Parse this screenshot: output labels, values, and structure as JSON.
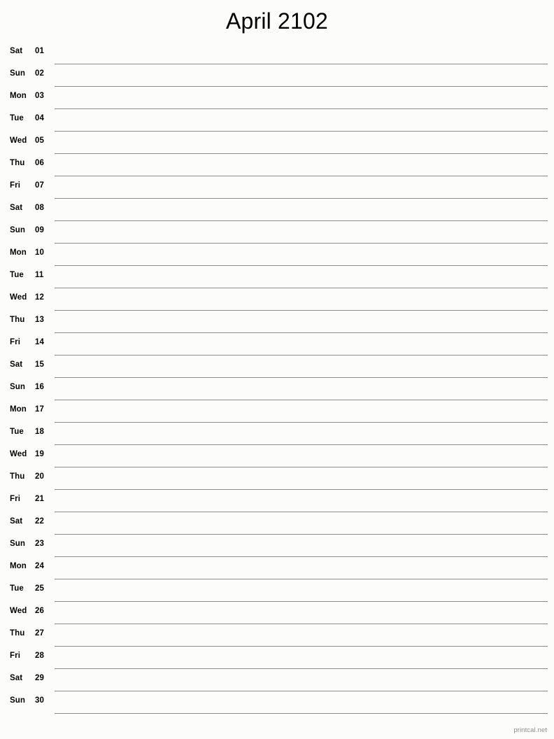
{
  "document": {
    "title": "April 2102",
    "footer_label": "printcal.net",
    "rule_color": "#8a8f88",
    "background_color": "#fcfdfa",
    "text_color": "#000000",
    "footer_color": "#8d8d8d"
  },
  "days": [
    {
      "weekday": "Sat",
      "number": "01"
    },
    {
      "weekday": "Sun",
      "number": "02"
    },
    {
      "weekday": "Mon",
      "number": "03"
    },
    {
      "weekday": "Tue",
      "number": "04"
    },
    {
      "weekday": "Wed",
      "number": "05"
    },
    {
      "weekday": "Thu",
      "number": "06"
    },
    {
      "weekday": "Fri",
      "number": "07"
    },
    {
      "weekday": "Sat",
      "number": "08"
    },
    {
      "weekday": "Sun",
      "number": "09"
    },
    {
      "weekday": "Mon",
      "number": "10"
    },
    {
      "weekday": "Tue",
      "number": "11"
    },
    {
      "weekday": "Wed",
      "number": "12"
    },
    {
      "weekday": "Thu",
      "number": "13"
    },
    {
      "weekday": "Fri",
      "number": "14"
    },
    {
      "weekday": "Sat",
      "number": "15"
    },
    {
      "weekday": "Sun",
      "number": "16"
    },
    {
      "weekday": "Mon",
      "number": "17"
    },
    {
      "weekday": "Tue",
      "number": "18"
    },
    {
      "weekday": "Wed",
      "number": "19"
    },
    {
      "weekday": "Thu",
      "number": "20"
    },
    {
      "weekday": "Fri",
      "number": "21"
    },
    {
      "weekday": "Sat",
      "number": "22"
    },
    {
      "weekday": "Sun",
      "number": "23"
    },
    {
      "weekday": "Mon",
      "number": "24"
    },
    {
      "weekday": "Tue",
      "number": "25"
    },
    {
      "weekday": "Wed",
      "number": "26"
    },
    {
      "weekday": "Thu",
      "number": "27"
    },
    {
      "weekday": "Fri",
      "number": "28"
    },
    {
      "weekday": "Sat",
      "number": "29"
    },
    {
      "weekday": "Sun",
      "number": "30"
    }
  ]
}
